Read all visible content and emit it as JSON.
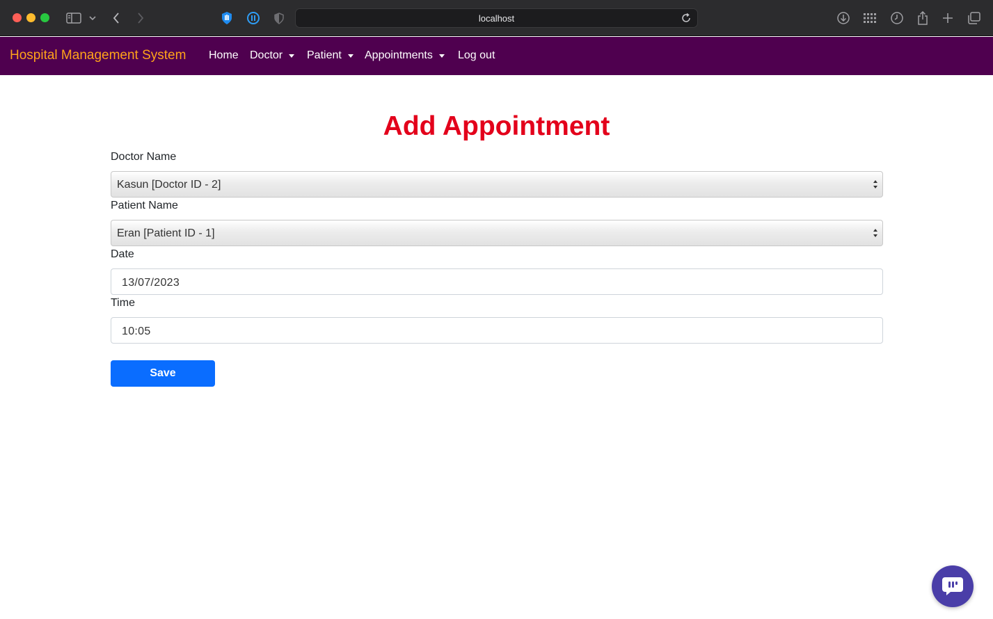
{
  "browser": {
    "url": "localhost",
    "icons": [
      "sidebar-icon",
      "chevron-down-icon",
      "back-icon",
      "forward-icon",
      "hand-extension-icon",
      "pause-extension-icon",
      "shield-icon",
      "reload-icon",
      "download-icon",
      "grid-icon",
      "history-icon",
      "share-icon",
      "new-tab-icon",
      "tabs-overview-icon"
    ]
  },
  "navbar": {
    "brand": "Hospital Management System",
    "brand_color": "#ffa31a",
    "background": "#4f004f",
    "items": [
      {
        "label": "Home"
      },
      {
        "label": "Doctor"
      },
      {
        "label": "Patient"
      },
      {
        "label": "Appointments"
      },
      {
        "label": "Log out"
      }
    ]
  },
  "form": {
    "title": "Add Appointment",
    "title_color": "#e3001b",
    "doctor": {
      "label": "Doctor Name",
      "value": "Kasun [Doctor ID - 2]"
    },
    "patient": {
      "label": "Patient Name",
      "value": "Eran [Patient ID - 1]"
    },
    "date": {
      "label": "Date",
      "value": "13/07/2023"
    },
    "time": {
      "label": "Time",
      "value": "10:05"
    },
    "save_label": "Save",
    "save_color": "#0a6dff"
  },
  "chat_widget": {
    "icon": "chat-icon",
    "color": "#4a3ea8"
  }
}
